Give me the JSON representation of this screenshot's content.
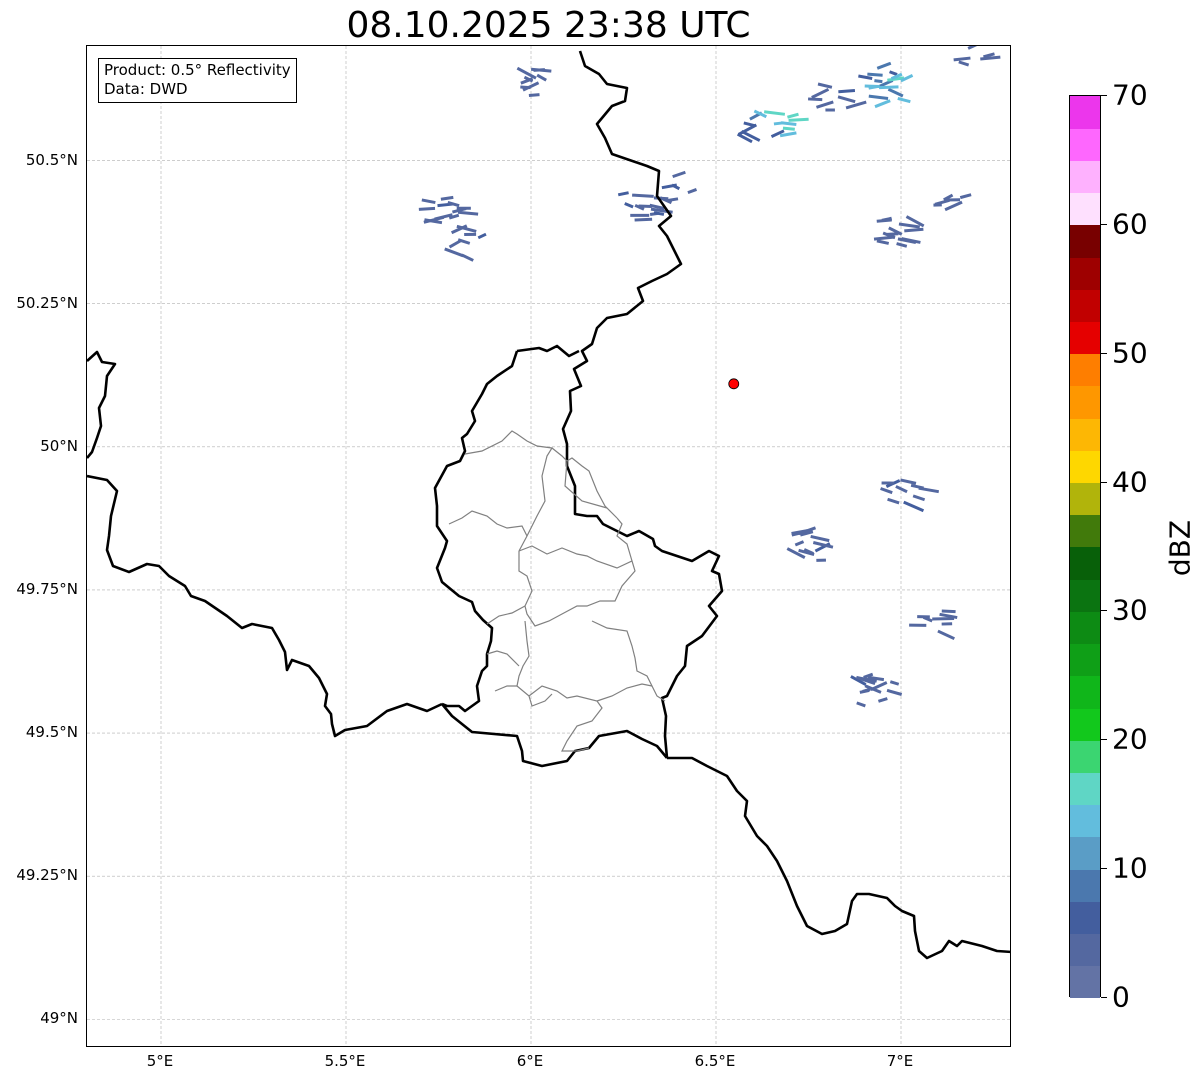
{
  "title": "08.10.2025 23:38 UTC",
  "info_box": {
    "product": "Product: 0.5° Reflectivity",
    "source": "Data: DWD"
  },
  "lat_ticks": [
    {
      "value": 50.5,
      "label": "50.5°N"
    },
    {
      "value": 50.25,
      "label": "50.25°N"
    },
    {
      "value": 50.0,
      "label": "50°N"
    },
    {
      "value": 49.75,
      "label": "49.75°N"
    },
    {
      "value": 49.5,
      "label": "49.5°N"
    },
    {
      "value": 49.25,
      "label": "49.25°N"
    },
    {
      "value": 49.0,
      "label": "49°N"
    }
  ],
  "lon_ticks": [
    {
      "value": 5.0,
      "label": "5°E"
    },
    {
      "value": 5.5,
      "label": "5.5°E"
    },
    {
      "value": 6.0,
      "label": "6°E"
    },
    {
      "value": 6.5,
      "label": "6.5°E"
    },
    {
      "value": 7.0,
      "label": "7°E"
    }
  ],
  "map_extent": {
    "lon_min": 4.8,
    "lon_max": 7.3,
    "lat_min": 48.95,
    "lat_max": 50.7
  },
  "radar_site": {
    "lon": 6.548,
    "lat": 50.11,
    "color": "#ff0000"
  },
  "colorbar": {
    "label": "dBZ",
    "min": 0,
    "max": 70,
    "step": 2.5,
    "tick_labels": [
      "0",
      "10",
      "20",
      "30",
      "40",
      "50",
      "60",
      "70"
    ],
    "colors": [
      "#6373a5",
      "#5468a0",
      "#435e9e",
      "#4b78ae",
      "#5a9dc6",
      "#62bddd",
      "#5fd6c5",
      "#3bd571",
      "#12c81c",
      "#10b61a",
      "#0f9f17",
      "#0d8b14",
      "#0b7411",
      "#086009",
      "#417a0b",
      "#b1b40b",
      "#fed700",
      "#fdb704",
      "#fe9700",
      "#fe7e00",
      "#e50000",
      "#c10000",
      "#9e0000",
      "#780000",
      "#fee0fe",
      "#feb1fe",
      "#fe67fe",
      "#ec36ec"
    ]
  },
  "radar_echoes": [
    {
      "lon": 6.0,
      "lat": 50.64,
      "dbz": 4
    },
    {
      "lon": 5.75,
      "lat": 50.41,
      "dbz": 5
    },
    {
      "lon": 5.82,
      "lat": 50.35,
      "dbz": 5
    },
    {
      "lon": 6.28,
      "lat": 50.42,
      "dbz": 6
    },
    {
      "lon": 6.38,
      "lat": 50.45,
      "dbz": 6
    },
    {
      "lon": 6.6,
      "lat": 50.56,
      "dbz": 8
    },
    {
      "lon": 6.65,
      "lat": 50.57,
      "dbz": 16
    },
    {
      "lon": 6.93,
      "lat": 50.64,
      "dbz": 9
    },
    {
      "lon": 6.95,
      "lat": 50.62,
      "dbz": 15
    },
    {
      "lon": 6.8,
      "lat": 50.61,
      "dbz": 5
    },
    {
      "lon": 7.17,
      "lat": 50.69,
      "dbz": 4
    },
    {
      "lon": 7.0,
      "lat": 49.92,
      "dbz": 6
    },
    {
      "lon": 6.74,
      "lat": 49.83,
      "dbz": 5
    },
    {
      "lon": 6.92,
      "lat": 49.58,
      "dbz": 5
    },
    {
      "lon": 6.97,
      "lat": 50.38,
      "dbz": 4
    },
    {
      "lon": 7.14,
      "lat": 50.44,
      "dbz": 4
    },
    {
      "lon": 7.06,
      "lat": 49.69,
      "dbz": 4
    }
  ]
}
